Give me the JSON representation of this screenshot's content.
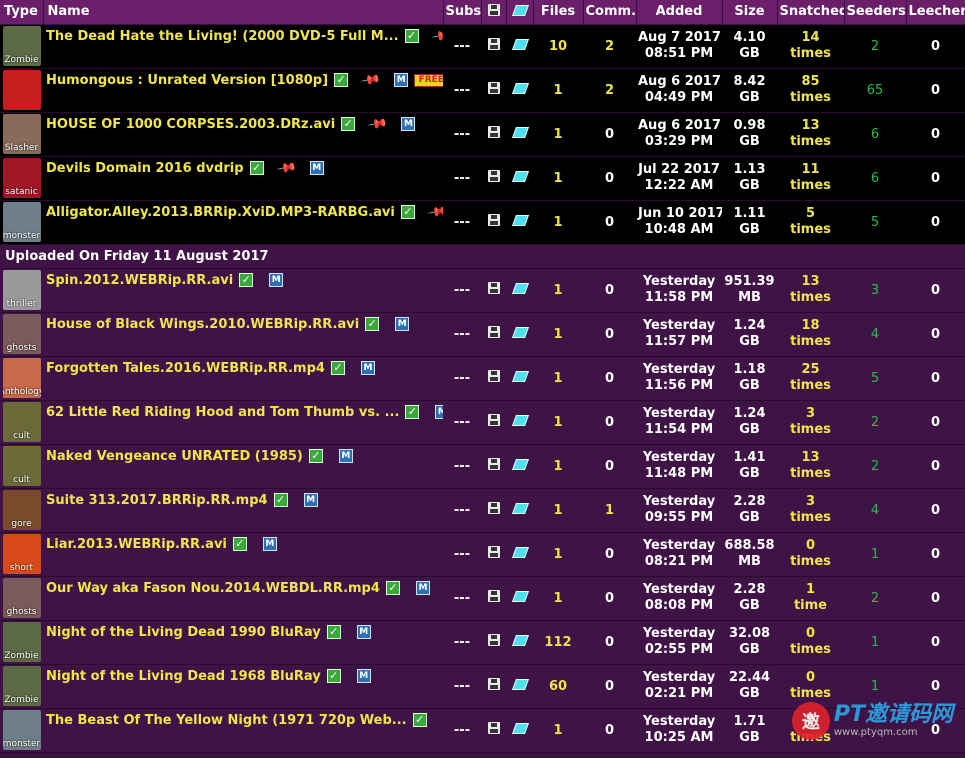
{
  "header": {
    "type": "Type",
    "name": "Name",
    "subs": "Subs",
    "files": "Files",
    "comments": "Comm.",
    "added": "Added",
    "size": "Size",
    "snatched": "Snatched",
    "seeders": "Seeders",
    "leechers": "Leechers"
  },
  "separator": "Uploaded On Friday 11 August 2017",
  "sticky_rows": [
    {
      "cat": "Zombie",
      "catColor": "#5d6a46",
      "name": "The Dead Hate the Living! (2000 DVD-5 Full M...",
      "pin": true,
      "free": false,
      "subs": "---",
      "files": "10",
      "comm": "2",
      "date": "Aug 7 2017",
      "time": "08:51 PM",
      "size1": "4.10",
      "size2": "GB",
      "snat1": "14",
      "snat2": "times",
      "seed": "2",
      "leech": "0"
    },
    {
      "cat": "",
      "catColor": "#c41e1e",
      "name": "Humongous : Unrated Version [1080p]",
      "pin": true,
      "free": true,
      "freeLabel": "FREE",
      "subs": "---",
      "files": "1",
      "comm": "2",
      "date": "Aug 6 2017",
      "time": "04:49 PM",
      "size1": "8.42",
      "size2": "GB",
      "snat1": "85",
      "snat2": "times",
      "seed": "65",
      "leech": "0"
    },
    {
      "cat": "Slasher",
      "catColor": "#8a6a5a",
      "name": "HOUSE OF 1000 CORPSES.2003.DRz.avi",
      "pin": true,
      "free": false,
      "subs": "---",
      "files": "1",
      "comm": "0",
      "date": "Aug 6 2017",
      "time": "03:29 PM",
      "size1": "0.98",
      "size2": "GB",
      "snat1": "13",
      "snat2": "times",
      "seed": "6",
      "leech": "0"
    },
    {
      "cat": "satanic",
      "catColor": "#a01626",
      "name": "Devils Domain 2016 dvdrip",
      "pin": true,
      "free": false,
      "subs": "---",
      "files": "1",
      "comm": "0",
      "date": "Jul 22 2017",
      "time": "12:22 AM",
      "size1": "1.13",
      "size2": "GB",
      "snat1": "11",
      "snat2": "times",
      "seed": "6",
      "leech": "0"
    },
    {
      "cat": "monster",
      "catColor": "#6f7f88",
      "name": "Alligator.Alley.2013.BRRip.XviD.MP3-RARBG.avi",
      "pin": true,
      "free": false,
      "subs": "---",
      "files": "1",
      "comm": "0",
      "date": "Jun 10 2017",
      "time": "10:48 AM",
      "size1": "1.11",
      "size2": "GB",
      "snat1": "5",
      "snat2": "times",
      "seed": "5",
      "leech": "0"
    }
  ],
  "rows": [
    {
      "cat": "thriller",
      "catColor": "#9a9a9a",
      "name": "Spin.2012.WEBRip.RR.avi",
      "subs": "---",
      "files": "1",
      "comm": "0",
      "date": "Yesterday",
      "time": "11:58 PM",
      "size1": "951.39",
      "size2": "MB",
      "snat1": "13",
      "snat2": "times",
      "seed": "3",
      "leech": "0"
    },
    {
      "cat": "ghosts",
      "catColor": "#7a5a5a",
      "name": "House of Black Wings.2010.WEBRip.RR.avi",
      "subs": "---",
      "files": "1",
      "comm": "0",
      "date": "Yesterday",
      "time": "11:57 PM",
      "size1": "1.24",
      "size2": "GB",
      "snat1": "18",
      "snat2": "times",
      "seed": "4",
      "leech": "0"
    },
    {
      "cat": "Anthology",
      "catColor": "#c86a4a",
      "name": "Forgotten Tales.2016.WEBRip.RR.mp4",
      "subs": "---",
      "files": "1",
      "comm": "0",
      "date": "Yesterday",
      "time": "11:56 PM",
      "size1": "1.18",
      "size2": "GB",
      "snat1": "25",
      "snat2": "times",
      "seed": "5",
      "leech": "0"
    },
    {
      "cat": "cult",
      "catColor": "#6b6b3a",
      "name": "62 Little Red Riding Hood and Tom Thumb vs. ...",
      "subs": "---",
      "files": "1",
      "comm": "0",
      "date": "Yesterday",
      "time": "11:54 PM",
      "size1": "1.24",
      "size2": "GB",
      "snat1": "3",
      "snat2": "times",
      "seed": "2",
      "leech": "0"
    },
    {
      "cat": "cult",
      "catColor": "#6b6b3a",
      "name": "Naked Vengeance UNRATED (1985)",
      "subs": "---",
      "files": "1",
      "comm": "0",
      "date": "Yesterday",
      "time": "11:48 PM",
      "size1": "1.41",
      "size2": "GB",
      "snat1": "13",
      "snat2": "times",
      "seed": "2",
      "leech": "0"
    },
    {
      "cat": "gore",
      "catColor": "#7a4a2a",
      "name": "Suite 313.2017.BRRip.RR.mp4",
      "subs": "---",
      "files": "1",
      "comm": "1",
      "date": "Yesterday",
      "time": "09:55 PM",
      "size1": "2.28",
      "size2": "GB",
      "snat1": "3",
      "snat2": "times",
      "seed": "4",
      "leech": "0"
    },
    {
      "cat": "short",
      "catColor": "#d84a1a",
      "name": "Liar.2013.WEBRip.RR.avi",
      "subs": "---",
      "files": "1",
      "comm": "0",
      "date": "Yesterday",
      "time": "08:21 PM",
      "size1": "688.58",
      "size2": "MB",
      "snat1": "0",
      "snat2": "times",
      "seed": "1",
      "leech": "0"
    },
    {
      "cat": "ghosts",
      "catColor": "#7a5a5a",
      "name": "Our Way aka Fason Nou.2014.WEBDL.RR.mp4",
      "subs": "---",
      "files": "1",
      "comm": "0",
      "date": "Yesterday",
      "time": "08:08 PM",
      "size1": "2.28",
      "size2": "GB",
      "snat1": "1",
      "snat2": "time",
      "seed": "2",
      "leech": "0"
    },
    {
      "cat": "Zombie",
      "catColor": "#5d6a46",
      "name": "Night of the Living Dead 1990 BluRay",
      "subs": "---",
      "files": "112",
      "comm": "0",
      "date": "Yesterday",
      "time": "02:55 PM",
      "size1": "32.08",
      "size2": "GB",
      "snat1": "0",
      "snat2": "times",
      "seed": "1",
      "leech": "0"
    },
    {
      "cat": "Zombie",
      "catColor": "#5d6a46",
      "name": "Night of the Living Dead 1968 BluRay",
      "subs": "---",
      "files": "60",
      "comm": "0",
      "date": "Yesterday",
      "time": "02:21 PM",
      "size1": "22.44",
      "size2": "GB",
      "snat1": "0",
      "snat2": "times",
      "seed": "1",
      "leech": "0"
    },
    {
      "cat": "monster",
      "catColor": "#6f7f88",
      "name": "The Beast Of The Yellow Night (1971 720p Web...",
      "subs": "---",
      "files": "1",
      "comm": "0",
      "date": "Yesterday",
      "time": "10:25 AM",
      "size1": "1.71",
      "size2": "GB",
      "snat1": "0",
      "snat2": "times",
      "seed": "",
      "leech": "0"
    }
  ],
  "watermark": {
    "badge": "邀",
    "text": "PT邀请码网",
    "url": "www.ptyqm.com"
  }
}
